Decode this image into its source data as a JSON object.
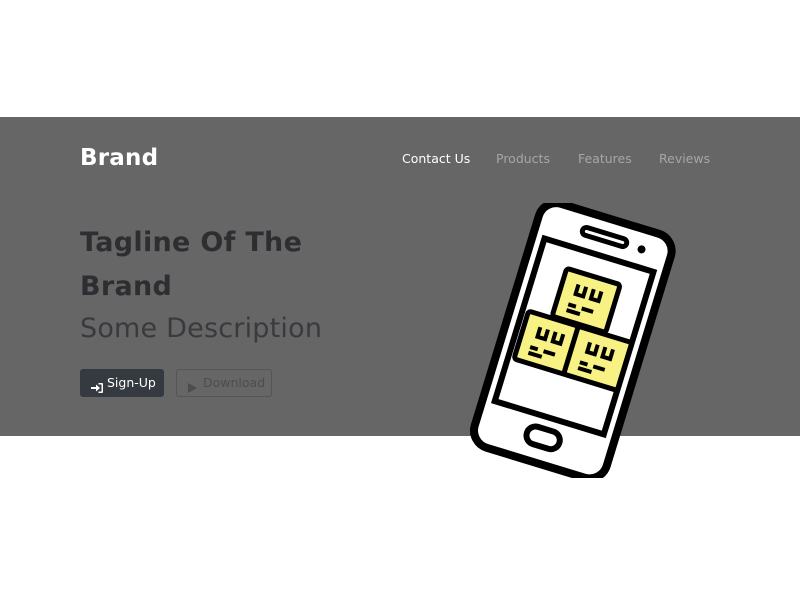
{
  "header": {
    "brand": "Brand",
    "nav": [
      {
        "label": "Contact Us",
        "active": true
      },
      {
        "label": "Products",
        "active": false
      },
      {
        "label": "Features",
        "active": false
      },
      {
        "label": "Reviews",
        "active": false
      }
    ]
  },
  "hero": {
    "tagline": "Tagline Of The Brand",
    "description": "Some Description",
    "signup_label": "Sign-Up",
    "signup_icon": "sign-in-icon",
    "download_label": "Download",
    "download_icon": "play-icon",
    "illustration": "phone-with-packages-icon"
  },
  "colors": {
    "hero_background": "#666666",
    "brand_text": "#ffffff",
    "nav_active": "#ffffff",
    "nav_inactive": "#a6a6a6",
    "signup_button": "#343a40",
    "package_fill": "#f7f283"
  }
}
